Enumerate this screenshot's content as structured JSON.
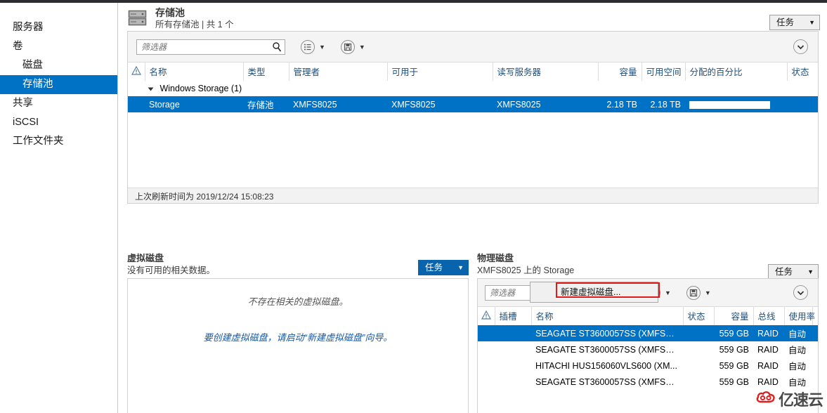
{
  "sidebar": {
    "items": [
      {
        "label": "服务器",
        "name": "servers",
        "indent": false,
        "selected": false
      },
      {
        "label": "卷",
        "name": "volumes",
        "indent": false,
        "selected": false
      },
      {
        "label": "磁盘",
        "name": "disks",
        "indent": true,
        "selected": false
      },
      {
        "label": "存储池",
        "name": "storage-pools",
        "indent": true,
        "selected": true
      },
      {
        "label": "共享",
        "name": "shares",
        "indent": false,
        "selected": false
      },
      {
        "label": "iSCSI",
        "name": "iscsi",
        "indent": false,
        "selected": false
      },
      {
        "label": "工作文件夹",
        "name": "work-folders",
        "indent": false,
        "selected": false
      }
    ]
  },
  "pools_panel": {
    "icon": "storage-pool-icon",
    "title": "存储池",
    "subtitle": "所有存储池 | 共 1 个",
    "task_label": "任务",
    "caret": "▼",
    "filter_placeholder": "筛选器",
    "filter_value": "",
    "search_icon": "search-icon",
    "list_icon": "list-view-icon",
    "save_icon": "save-icon",
    "expand_icon": "chevron-down-icon",
    "warn_icon": "warning-triangle-icon",
    "columns": [
      "名称",
      "类型",
      "管理者",
      "可用于",
      "读写服务器",
      "容量",
      "可用空间",
      "分配的百分比",
      "状态"
    ],
    "group_row": "Windows Storage (1)",
    "rows": [
      {
        "name": "Storage",
        "type": "存储池",
        "managed_by": "XMFS8025",
        "available_to": "XMFS8025",
        "read_write_server": "XMFS8025",
        "capacity": "2.18 TB",
        "free_space": "2.18 TB",
        "allocated_pct": "",
        "status": "",
        "selected": true
      }
    ],
    "status_bar": "上次刷新时间为 2019/12/24 15:08:23"
  },
  "virtual_disks_panel": {
    "title": "虚拟磁盘",
    "subtitle": "没有可用的相关数据。",
    "task_label": "任务",
    "caret": "▼",
    "empty_primary": "不存在相关的虚拟磁盘。",
    "empty_secondary": "要创建虚拟磁盘，请启动“新建虚拟磁盘”向导。",
    "menu": {
      "items": [
        {
          "label": "新建虚拟磁盘...",
          "highlighted": true
        }
      ]
    }
  },
  "physical_disks_panel": {
    "title": "物理磁盘",
    "subtitle": "XMFS8025 上的 Storage",
    "task_label": "任务",
    "caret": "▼",
    "filter_placeholder": "筛选器",
    "filter_value": "",
    "search_icon": "search-icon",
    "list_icon": "list-view-icon",
    "save_icon": "save-icon",
    "expand_icon": "chevron-down-icon",
    "warn_icon": "warning-triangle-icon",
    "columns": [
      "插槽",
      "名称",
      "状态",
      "容量",
      "总线",
      "使用率"
    ],
    "rows": [
      {
        "slot": "",
        "name": "SEAGATE ST3600057SS (XMFS802...",
        "status": "",
        "capacity": "559 GB",
        "bus": "RAID",
        "usage": "自动",
        "selected": true
      },
      {
        "slot": "",
        "name": "SEAGATE ST3600057SS (XMFS802...",
        "status": "",
        "capacity": "559 GB",
        "bus": "RAID",
        "usage": "自动",
        "selected": false
      },
      {
        "slot": "",
        "name": "HITACHI HUS156060VLS600 (XM...",
        "status": "",
        "capacity": "559 GB",
        "bus": "RAID",
        "usage": "自动",
        "selected": false
      },
      {
        "slot": "",
        "name": "SEAGATE ST3600057SS (XMFS802...",
        "status": "",
        "capacity": "559 GB",
        "bus": "RAID",
        "usage": "自动",
        "selected": false
      }
    ]
  },
  "watermark": {
    "text": "亿速云",
    "logo": "cloud-logo-icon",
    "color": "#e02020"
  },
  "theme": {
    "accent": "#0072c6",
    "accent_active": "#0a64ad",
    "highlight_box": "#e01b1b",
    "link_blue": "#1359a5"
  }
}
